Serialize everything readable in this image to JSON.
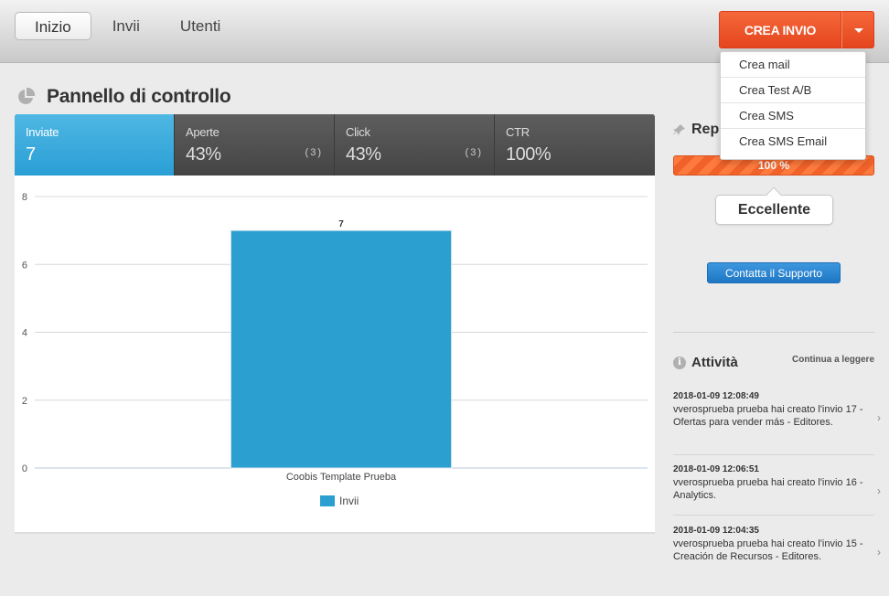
{
  "nav": {
    "items": [
      "Inizio",
      "Invii",
      "Utenti"
    ]
  },
  "crea": {
    "label": "CREA INVIO",
    "menu": [
      "Crea mail",
      "Crea Test A/B",
      "Crea SMS",
      "Crea SMS Email"
    ]
  },
  "page": {
    "title": "Pannello di controllo"
  },
  "stats": [
    {
      "label": "Inviate",
      "value": "7",
      "count": ""
    },
    {
      "label": "Aperte",
      "value": "43%",
      "count": "(3)"
    },
    {
      "label": "Click",
      "value": "43%",
      "count": "(3)"
    },
    {
      "label": "CTR",
      "value": "100%",
      "count": ""
    }
  ],
  "chart_data": {
    "type": "bar",
    "categories": [
      "Coobis Template Prueba"
    ],
    "series": [
      {
        "name": "Invii",
        "values": [
          7
        ]
      }
    ],
    "data_labels": [
      "7"
    ],
    "y_ticks": [
      0,
      2,
      4,
      6,
      8
    ],
    "ylim": [
      0,
      8
    ],
    "grid": true,
    "legend": "bottom",
    "color": "#2a9fd0"
  },
  "reputation": {
    "title": "Rep",
    "percent": 100,
    "percent_label": "100 %",
    "rating": "Eccellente"
  },
  "support": {
    "label": "Contatta il Supporto"
  },
  "activity": {
    "title": "Attività",
    "read_more": "Continua a leggere",
    "items": [
      {
        "date": "2018-01-09 12:08:49",
        "text": "vverosprueba prueba hai creato l'invio 17 - Ofertas para vender más - Editores."
      },
      {
        "date": "2018-01-09 12:06:51",
        "text": "vverosprueba prueba hai creato l'invio 16 - Analytics."
      },
      {
        "date": "2018-01-09 12:04:35",
        "text": "vverosprueba prueba hai creato l'invio 15 - Creación de Recursos - Editores."
      }
    ]
  },
  "colors": {
    "accent": "#e5451d",
    "blue": "#2a9fd6",
    "button_blue": "#1f77c4"
  }
}
